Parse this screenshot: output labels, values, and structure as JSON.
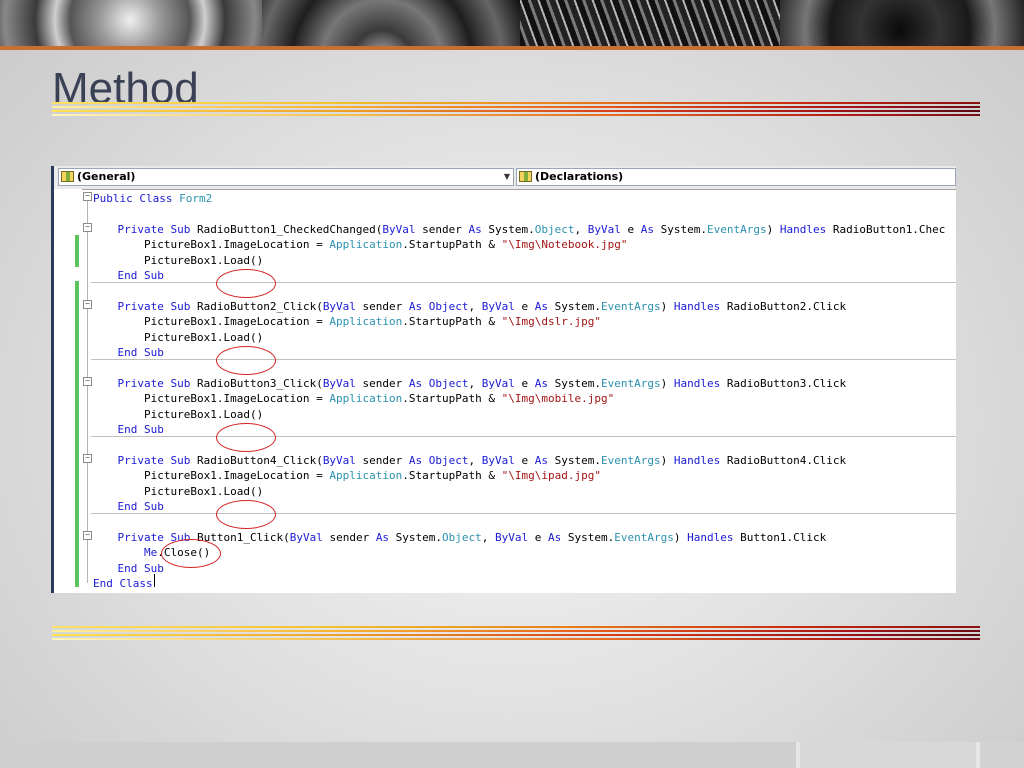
{
  "slide": {
    "title": "Method"
  },
  "editor": {
    "object_dropdown": "(General)",
    "procedure_dropdown": "(Declarations)",
    "lines": [
      [
        {
          "t": "Public Class",
          "c": "kw"
        },
        {
          "t": " "
        },
        {
          "t": "Form2",
          "c": "ty"
        }
      ],
      [],
      [
        {
          "t": "    "
        },
        {
          "t": "Private Sub",
          "c": "kw"
        },
        {
          "t": " RadioButton1_CheckedChanged("
        },
        {
          "t": "ByVal",
          "c": "kw"
        },
        {
          "t": " sender "
        },
        {
          "t": "As",
          "c": "kw"
        },
        {
          "t": " System."
        },
        {
          "t": "Object",
          "c": "ty"
        },
        {
          "t": ", "
        },
        {
          "t": "ByVal",
          "c": "kw"
        },
        {
          "t": " e "
        },
        {
          "t": "As",
          "c": "kw"
        },
        {
          "t": " System."
        },
        {
          "t": "EventArgs",
          "c": "ty"
        },
        {
          "t": ") "
        },
        {
          "t": "Handles",
          "c": "kw"
        },
        {
          "t": " RadioButton1.Chec"
        }
      ],
      [
        {
          "t": "        PictureBox1.ImageLocation = "
        },
        {
          "t": "Application",
          "c": "ty"
        },
        {
          "t": ".StartupPath & "
        },
        {
          "t": "\"\\Img\\Notebook.jpg\"",
          "c": "st"
        }
      ],
      [
        {
          "t": "        PictureBox1.Load()"
        }
      ],
      [
        {
          "t": "    "
        },
        {
          "t": "End Sub",
          "c": "kw"
        }
      ],
      [],
      [
        {
          "t": "    "
        },
        {
          "t": "Private Sub",
          "c": "kw"
        },
        {
          "t": " RadioButton2_Click("
        },
        {
          "t": "ByVal",
          "c": "kw"
        },
        {
          "t": " sender "
        },
        {
          "t": "As",
          "c": "kw"
        },
        {
          "t": " "
        },
        {
          "t": "Object",
          "c": "kw"
        },
        {
          "t": ", "
        },
        {
          "t": "ByVal",
          "c": "kw"
        },
        {
          "t": " e "
        },
        {
          "t": "As",
          "c": "kw"
        },
        {
          "t": " System."
        },
        {
          "t": "EventArgs",
          "c": "ty"
        },
        {
          "t": ") "
        },
        {
          "t": "Handles",
          "c": "kw"
        },
        {
          "t": " RadioButton2.Click"
        }
      ],
      [
        {
          "t": "        PictureBox1.ImageLocation = "
        },
        {
          "t": "Application",
          "c": "ty"
        },
        {
          "t": ".StartupPath & "
        },
        {
          "t": "\"\\Img\\dslr.jpg\"",
          "c": "st"
        }
      ],
      [
        {
          "t": "        PictureBox1.Load()"
        }
      ],
      [
        {
          "t": "    "
        },
        {
          "t": "End Sub",
          "c": "kw"
        }
      ],
      [],
      [
        {
          "t": "    "
        },
        {
          "t": "Private Sub",
          "c": "kw"
        },
        {
          "t": " RadioButton3_Click("
        },
        {
          "t": "ByVal",
          "c": "kw"
        },
        {
          "t": " sender "
        },
        {
          "t": "As",
          "c": "kw"
        },
        {
          "t": " "
        },
        {
          "t": "Object",
          "c": "kw"
        },
        {
          "t": ", "
        },
        {
          "t": "ByVal",
          "c": "kw"
        },
        {
          "t": " e "
        },
        {
          "t": "As",
          "c": "kw"
        },
        {
          "t": " System."
        },
        {
          "t": "EventArgs",
          "c": "ty"
        },
        {
          "t": ") "
        },
        {
          "t": "Handles",
          "c": "kw"
        },
        {
          "t": " RadioButton3.Click"
        }
      ],
      [
        {
          "t": "        PictureBox1.ImageLocation = "
        },
        {
          "t": "Application",
          "c": "ty"
        },
        {
          "t": ".StartupPath & "
        },
        {
          "t": "\"\\Img\\mobile.jpg\"",
          "c": "st"
        }
      ],
      [
        {
          "t": "        PictureBox1.Load()"
        }
      ],
      [
        {
          "t": "    "
        },
        {
          "t": "End Sub",
          "c": "kw"
        }
      ],
      [],
      [
        {
          "t": "    "
        },
        {
          "t": "Private Sub",
          "c": "kw"
        },
        {
          "t": " RadioButton4_Click("
        },
        {
          "t": "ByVal",
          "c": "kw"
        },
        {
          "t": " sender "
        },
        {
          "t": "As",
          "c": "kw"
        },
        {
          "t": " "
        },
        {
          "t": "Object",
          "c": "kw"
        },
        {
          "t": ", "
        },
        {
          "t": "ByVal",
          "c": "kw"
        },
        {
          "t": " e "
        },
        {
          "t": "As",
          "c": "kw"
        },
        {
          "t": " System."
        },
        {
          "t": "EventArgs",
          "c": "ty"
        },
        {
          "t": ") "
        },
        {
          "t": "Handles",
          "c": "kw"
        },
        {
          "t": " RadioButton4.Click"
        }
      ],
      [
        {
          "t": "        PictureBox1.ImageLocation = "
        },
        {
          "t": "Application",
          "c": "ty"
        },
        {
          "t": ".StartupPath & "
        },
        {
          "t": "\"\\Img\\ipad.jpg\"",
          "c": "st"
        }
      ],
      [
        {
          "t": "        PictureBox1.Load()"
        }
      ],
      [
        {
          "t": "    "
        },
        {
          "t": "End Sub",
          "c": "kw"
        }
      ],
      [],
      [
        {
          "t": "    "
        },
        {
          "t": "Private Sub",
          "c": "kw"
        },
        {
          "t": " Button1_Click("
        },
        {
          "t": "ByVal",
          "c": "kw"
        },
        {
          "t": " sender "
        },
        {
          "t": "As",
          "c": "kw"
        },
        {
          "t": " System."
        },
        {
          "t": "Object",
          "c": "ty"
        },
        {
          "t": ", "
        },
        {
          "t": "ByVal",
          "c": "kw"
        },
        {
          "t": " e "
        },
        {
          "t": "As",
          "c": "kw"
        },
        {
          "t": " System."
        },
        {
          "t": "EventArgs",
          "c": "ty"
        },
        {
          "t": ") "
        },
        {
          "t": "Handles",
          "c": "kw"
        },
        {
          "t": " Button1.Click"
        }
      ],
      [
        {
          "t": "        "
        },
        {
          "t": "Me",
          "c": "kw"
        },
        {
          "t": ".Close()"
        }
      ],
      [
        {
          "t": "    "
        },
        {
          "t": "End Sub",
          "c": "kw"
        }
      ],
      [
        {
          "t": "End Class",
          "c": "kw"
        }
      ]
    ]
  },
  "colors": {
    "keyword": "#1a1ad6",
    "type": "#2b91af",
    "string": "#a31515",
    "change_bar": "#5cc45c",
    "highlight_circle": "#d42323",
    "title": "#3a4154",
    "accent_line": "#c8702e"
  }
}
